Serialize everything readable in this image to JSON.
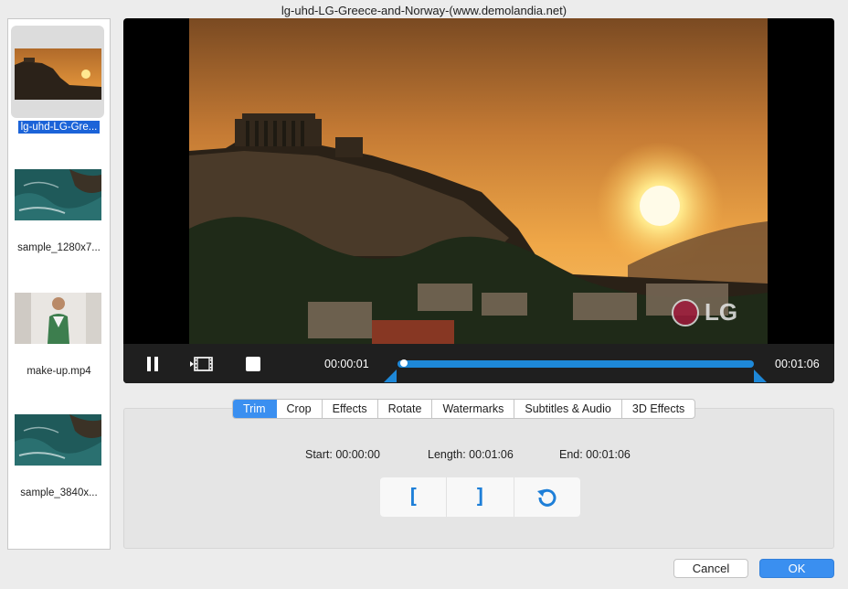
{
  "window": {
    "title": "lg-uhd-LG-Greece-and-Norway-(www.demolandia.net)"
  },
  "sidebar": {
    "items": [
      {
        "label": "lg-uhd-LG-Gre...",
        "selected": true,
        "thumb": "acropolis-sunset"
      },
      {
        "label": "sample_1280x7...",
        "selected": false,
        "thumb": "aerial-coast"
      },
      {
        "label": "make-up.mp4",
        "selected": false,
        "thumb": "woman-portrait"
      },
      {
        "label": "sample_3840x...",
        "selected": false,
        "thumb": "aerial-coast"
      }
    ]
  },
  "player": {
    "current_time": "00:00:01",
    "total_time": "00:01:06",
    "watermark": "LG",
    "controls": [
      "pause-icon",
      "film-icon",
      "stop-icon"
    ]
  },
  "tabs": [
    {
      "label": "Trim",
      "active": true
    },
    {
      "label": "Crop",
      "active": false
    },
    {
      "label": "Effects",
      "active": false
    },
    {
      "label": "Rotate",
      "active": false
    },
    {
      "label": "Watermarks",
      "active": false
    },
    {
      "label": "Subtitles & Audio",
      "active": false
    },
    {
      "label": "3D Effects",
      "active": false
    }
  ],
  "trim": {
    "start": "Start: 00:00:00",
    "length": "Length: 00:01:06",
    "end": "End: 00:01:06",
    "set_start_glyph": "[",
    "set_end_glyph": "]"
  },
  "footer": {
    "cancel_label": "Cancel",
    "ok_label": "OK"
  },
  "colors": {
    "accent": "#3a8ff0",
    "selection": "#1b63d8",
    "timeline": "#1e88d8"
  }
}
